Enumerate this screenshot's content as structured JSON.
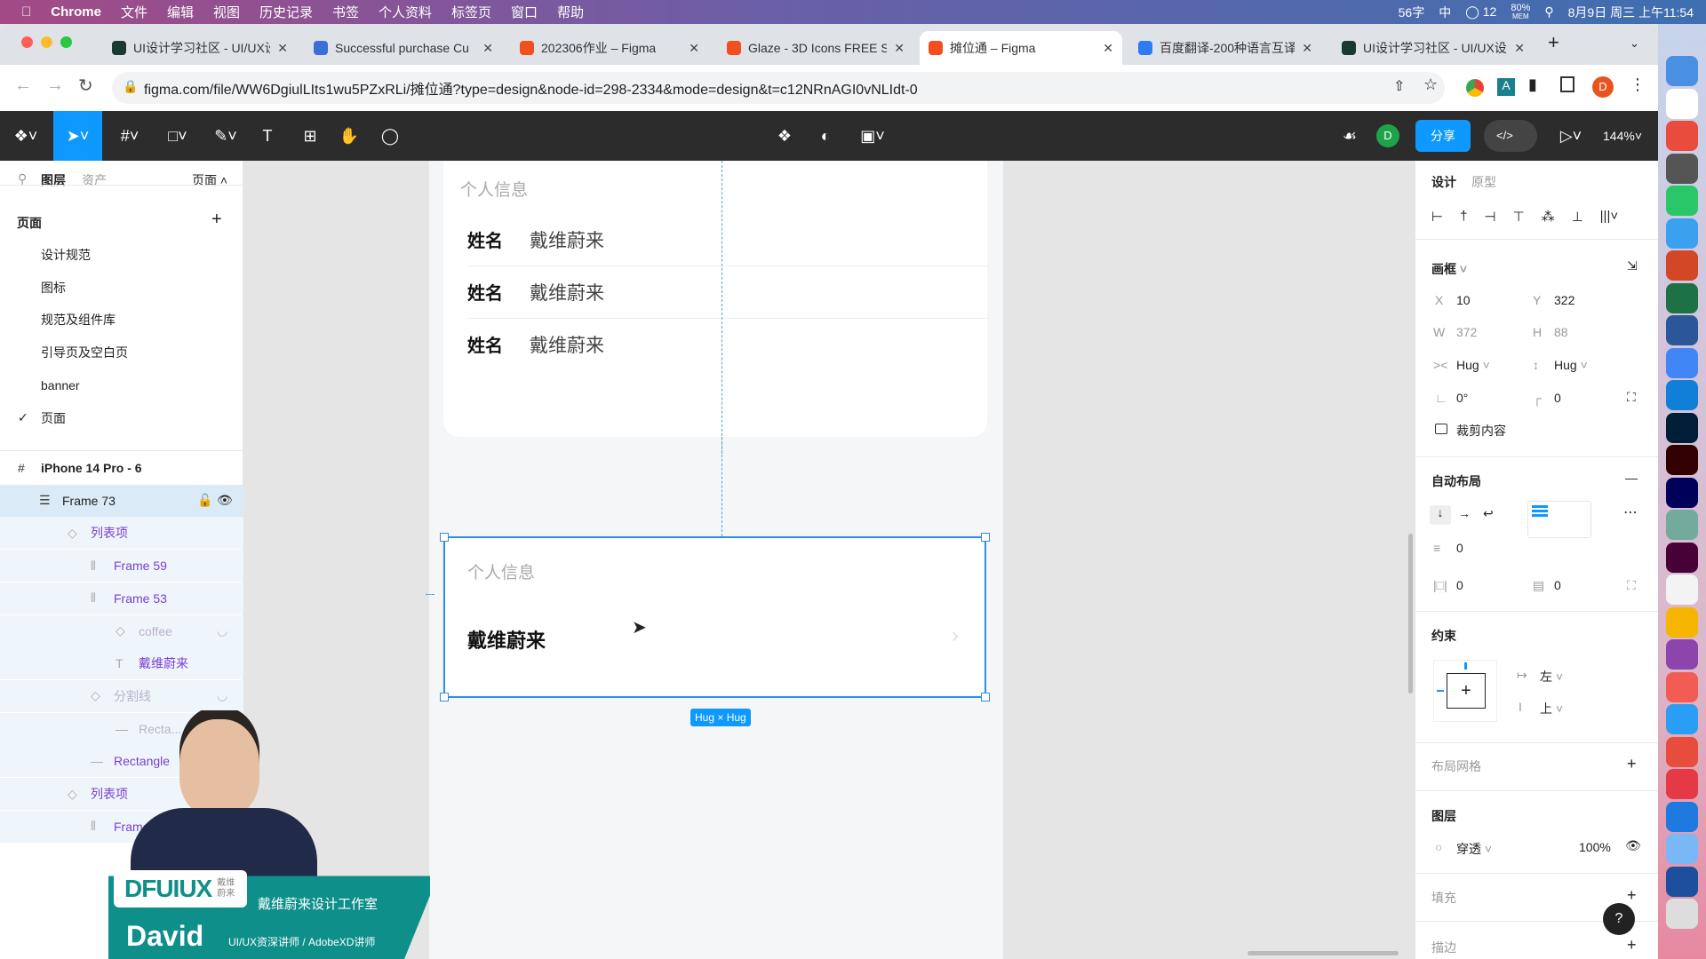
{
  "menubar": {
    "app": "Chrome",
    "items": [
      "文件",
      "编辑",
      "视图",
      "历史记录",
      "书签",
      "个人资料",
      "标签页",
      "窗口",
      "帮助"
    ],
    "status": {
      "words": "56字",
      "lang": "中",
      "notif": "12",
      "mem": "80%",
      "mem_label": "MEM",
      "datetime": "8月9日 周三 上午11:54"
    }
  },
  "tabs": [
    {
      "title": "UI设计学习社区 - UI/UX设",
      "color": "#1b3a2f"
    },
    {
      "title": "Successful purchase Cu",
      "color": "#3b6fd6"
    },
    {
      "title": "202306作业 – Figma",
      "color": "#f24e1e"
    },
    {
      "title": "Glaze - 3D Icons FREE S",
      "color": "#f24e1e"
    },
    {
      "title": "摊位通 – Figma",
      "color": "#f24e1e",
      "active": true
    },
    {
      "title": "百度翻译-200种语言互译",
      "color": "#2f7bf5"
    },
    {
      "title": "UI设计学习社区 - UI/UX设",
      "color": "#1b3a2f"
    }
  ],
  "address": {
    "url": "figma.com/file/WW6DgiulLIts1wu5PZxRLi/摊位通?type=design&node-id=298-2334&mode=design&t=c12NRnAGI0vNLIdt-0",
    "profile": "D"
  },
  "toolbar": {
    "share": "分享",
    "zoom": "144%",
    "avatar": "D"
  },
  "left_panel": {
    "tabs": [
      "图层",
      "资产"
    ],
    "pages_dropdown": "页面",
    "pages_title": "页面",
    "pages": [
      "设计规范",
      "图标",
      "规范及组件库",
      "引导页及空白页",
      "banner",
      "页面"
    ],
    "current_page": "页面",
    "layers": [
      {
        "name": "iPhone 14 Pro - 6",
        "icon": "frame-icon",
        "level": 0,
        "style": "bold"
      },
      {
        "name": "Frame 73",
        "icon": "autolayout-vertical-icon",
        "level": 1,
        "selected": true
      },
      {
        "name": "列表项",
        "icon": "component-instance-icon",
        "level": 2,
        "style": "purple"
      },
      {
        "name": "Frame 59",
        "icon": "autolayout-horizontal-icon",
        "level": 3,
        "style": "purple"
      },
      {
        "name": "Frame 53",
        "icon": "autolayout-horizontal-icon",
        "level": 3,
        "style": "purple"
      },
      {
        "name": "coffee",
        "icon": "component-instance-icon",
        "level": 4,
        "style": "hidden"
      },
      {
        "name": "戴维蔚来",
        "icon": "text-icon",
        "level": 4,
        "style": "purple"
      },
      {
        "name": "分割线",
        "icon": "component-instance-icon",
        "level": 3,
        "style": "hidden"
      },
      {
        "name": "Recta...",
        "icon": "line-icon",
        "level": 4,
        "style": "hidden"
      },
      {
        "name": "Rectangle",
        "icon": "line-icon",
        "level": 3,
        "style": "purple"
      },
      {
        "name": "列表项",
        "icon": "component-instance-icon",
        "level": 2,
        "style": "purple"
      },
      {
        "name": "Frame 59",
        "icon": "autolayout-horizontal-icon",
        "level": 3,
        "style": "purple"
      }
    ]
  },
  "canvas": {
    "card1": {
      "section": "个人信息",
      "rows": [
        {
          "label": "姓名",
          "value": "戴维蔚来"
        },
        {
          "label": "姓名",
          "value": "戴维蔚来"
        },
        {
          "label": "姓名",
          "value": "戴维蔚来"
        }
      ]
    },
    "card2": {
      "section": "个人信息",
      "value": "戴维蔚来"
    },
    "size_badge": "Hug × Hug"
  },
  "right_panel": {
    "tabs": [
      "设计",
      "原型"
    ],
    "frame": {
      "title": "画框",
      "x": "10",
      "y": "322",
      "w": "372",
      "h": "88",
      "w_mode": "Hug",
      "h_mode": "Hug",
      "rotation": "0°",
      "radius": "0",
      "clip": "裁剪内容"
    },
    "auto_layout": {
      "title": "自动布局",
      "gap": "0",
      "padding_h": "0",
      "padding_v": "0"
    },
    "constraints": {
      "title": "约束",
      "horizontal": "左",
      "vertical": "上"
    },
    "layout_grid": "布局网格",
    "layer": {
      "title": "图层",
      "blend": "穿透",
      "opacity": "100%"
    },
    "fill": "填充",
    "stroke": "描边",
    "help": "?"
  },
  "overlay": {
    "brand": "DFUIUX",
    "brand_sub": "戴维蔚来",
    "studio": "戴维蔚来设计工作室",
    "name": "David",
    "role": "UI/UX资深讲师 / AdobeXD讲师"
  },
  "colors": {
    "accent": "#0d99ff",
    "figma_dark": "#2c2c2c",
    "layer_purple": "#7b3fd1",
    "overlay_teal": "#0f8f8a"
  }
}
